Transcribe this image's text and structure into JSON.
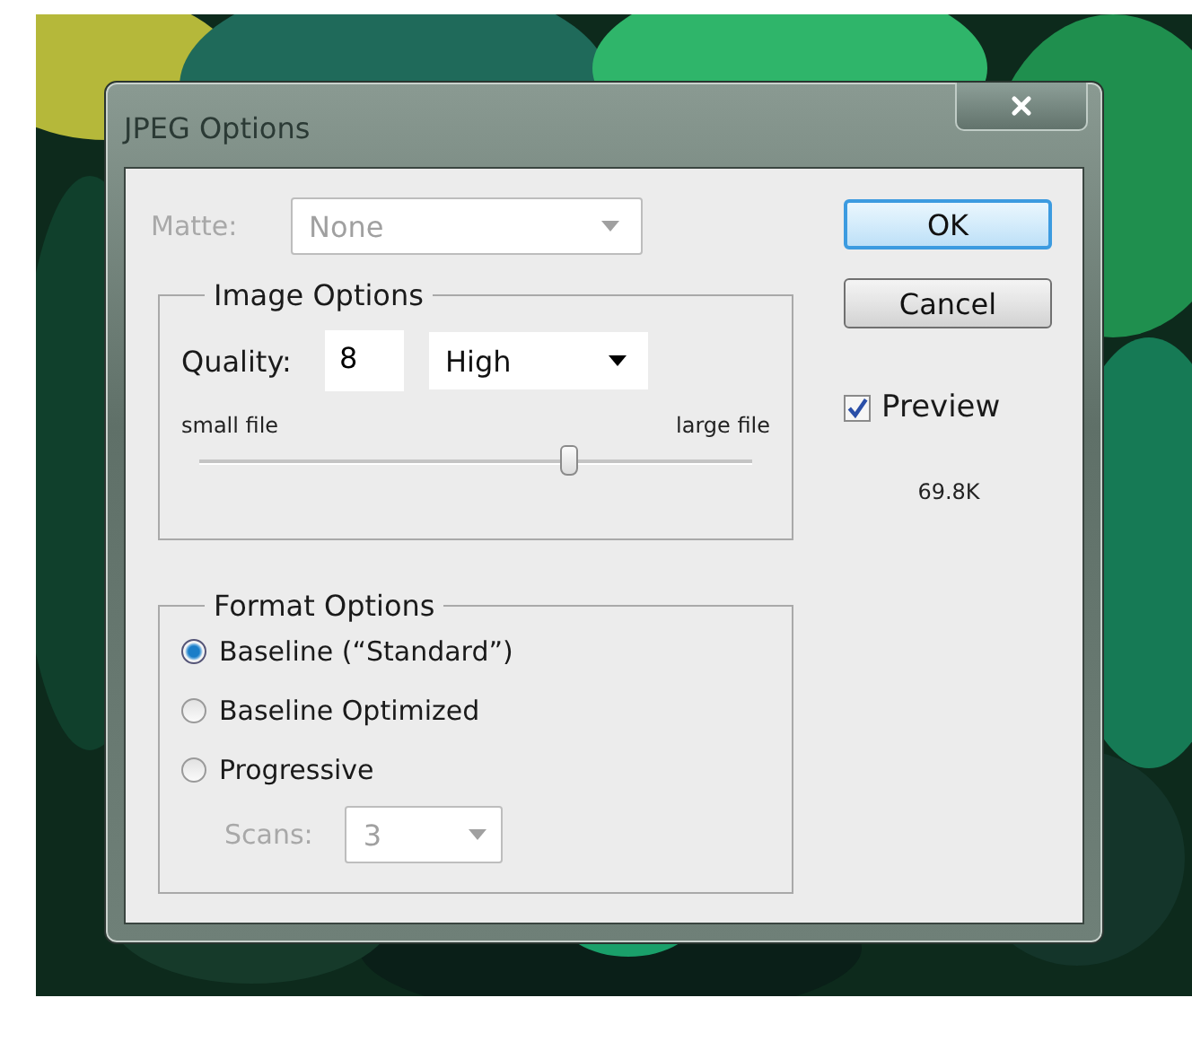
{
  "window": {
    "title": "JPEG Options"
  },
  "matte": {
    "label": "Matte:",
    "value": "None",
    "disabled": true
  },
  "image_options": {
    "title": "Image Options",
    "quality_label": "Quality:",
    "quality": "8",
    "preset": "High",
    "min_label": "small file",
    "max_label": "large file",
    "level": 0.67
  },
  "format_options": {
    "title": "Format Options",
    "choices": [
      {
        "label": "Baseline (“Standard”)",
        "selected": true
      },
      {
        "label": "Baseline Optimized",
        "selected": false
      },
      {
        "label": "Progressive",
        "selected": false
      }
    ],
    "scans": {
      "label": "Scans:",
      "value": "3",
      "disabled": true
    }
  },
  "buttons": [
    {
      "label": "OK",
      "default": true
    },
    {
      "label": "Cancel",
      "default": false
    }
  ],
  "preview": {
    "label": "Preview",
    "checked": true
  },
  "file_size": "69.8K"
}
